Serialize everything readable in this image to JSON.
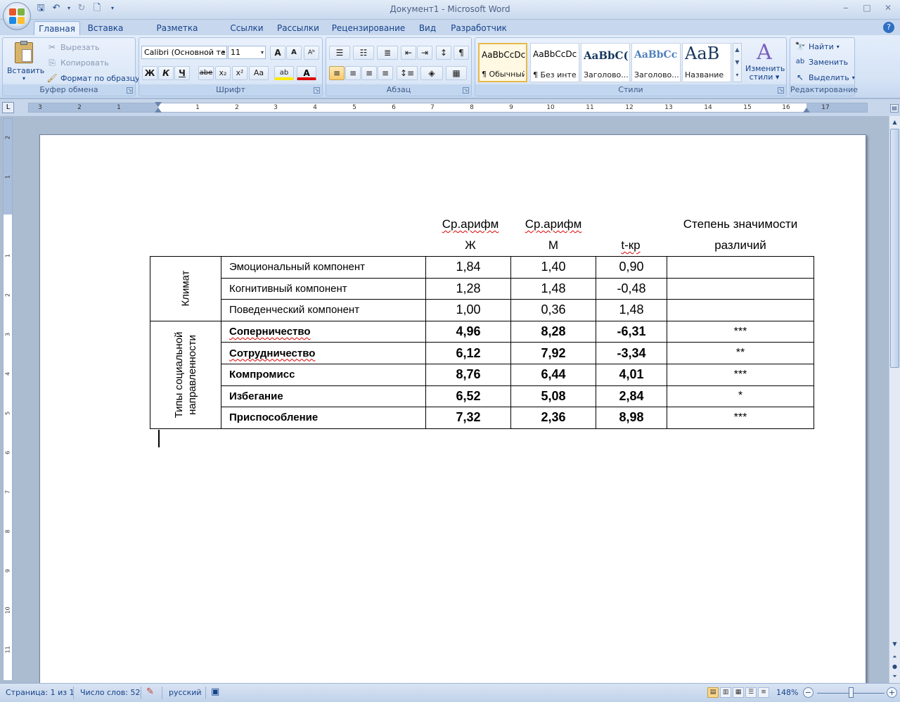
{
  "window": {
    "title": "Документ1 - Microsoft Word",
    "controls": [
      "‒",
      "□",
      "✕"
    ]
  },
  "qat": [
    "save-icon",
    "undo-icon",
    "redo-icon",
    "print-preview-icon"
  ],
  "tabs": [
    "Главная",
    "Вставка",
    "Разметка страницы",
    "Ссылки",
    "Рассылки",
    "Рецензирование",
    "Вид",
    "Разработчик"
  ],
  "ribbon": {
    "clipboard": {
      "label": "Буфер обмена",
      "paste": "Вставить",
      "cut": "Вырезать",
      "copy": "Копировать",
      "format_painter": "Формат по образцу"
    },
    "font": {
      "label": "Шрифт",
      "font_name": "Calibri (Основной те",
      "font_size": "11",
      "grow": "A",
      "shrink": "A",
      "clear": "Aᵇ",
      "bold": "Ж",
      "italic": "К",
      "underline": "Ч",
      "strike": "abe",
      "subscript": "x₂",
      "superscript": "x²",
      "case": "Aa",
      "highlight": "ab",
      "font_color": "A"
    },
    "paragraph": {
      "label": "Абзац"
    },
    "styles": {
      "label": "Стили",
      "tiles": [
        {
          "sample": "AaBbCcDc",
          "name": "¶ Обычный"
        },
        {
          "sample": "AaBbCcDc",
          "name": "¶ Без инте..."
        },
        {
          "sample": "AaBbC(",
          "name": "Заголово..."
        },
        {
          "sample": "AaBbCc",
          "name": "Заголово..."
        },
        {
          "sample": "AaB",
          "name": "Название"
        }
      ],
      "change_styles_1": "Изменить",
      "change_styles_2": "стили"
    },
    "editing": {
      "label": "Редактирование",
      "find": "Найти",
      "replace": "Заменить",
      "select": "Выделить"
    }
  },
  "ruler": {
    "tab_selector": "L",
    "left_numbers": [
      "3",
      "2",
      "1"
    ],
    "right_numbers": [
      "1",
      "2",
      "3",
      "4",
      "5",
      "6",
      "7",
      "8",
      "9",
      "10",
      "11",
      "12",
      "13",
      "14",
      "15",
      "16",
      "17"
    ],
    "vertical_numbers": [
      "2",
      "1",
      "1",
      "2",
      "3",
      "4",
      "5",
      "6",
      "7",
      "8",
      "9",
      "10",
      "11"
    ]
  },
  "document": {
    "headers": {
      "col_f_1": "Ср.арифм",
      "col_f_2": "Ж",
      "col_m_1": "Ср.арифм",
      "col_m_2": "М",
      "col_t": "t-кр",
      "col_sig_1": "Степень значимости",
      "col_sig_2": "различий"
    },
    "groups": {
      "climate": "Климат",
      "social_1": "Типы социальной",
      "social_2": "направленности"
    },
    "rows": [
      {
        "label": "Эмоциональный компонент",
        "f": "1,84",
        "m": "1,40",
        "t": "0,90",
        "sig": ""
      },
      {
        "label": "Когнитивный компонент",
        "f": "1,28",
        "m": "1,48",
        "t": "-0,48",
        "sig": ""
      },
      {
        "label": "Поведенческий компонент",
        "f": "1,00",
        "m": "0,36",
        "t": "1,48",
        "sig": ""
      },
      {
        "label": "Соперничество",
        "f": "4,96",
        "m": "8,28",
        "t": "-6,31",
        "sig": "***"
      },
      {
        "label": "Сотрудничество",
        "f": "6,12",
        "m": "7,92",
        "t": "-3,34",
        "sig": "**"
      },
      {
        "label": "Компромисс",
        "f": "8,76",
        "m": "6,44",
        "t": "4,01",
        "sig": "***"
      },
      {
        "label": "Избегание",
        "f": "6,52",
        "m": "5,08",
        "t": "2,84",
        "sig": "*"
      },
      {
        "label": "Приспособление",
        "f": "7,32",
        "m": "2,36",
        "t": "8,98",
        "sig": "***"
      }
    ]
  },
  "statusbar": {
    "page": "Страница: 1 из 1",
    "words": "Число слов: 52",
    "language": "русский",
    "zoom": "148%",
    "zoom_out": "−",
    "zoom_in": "+"
  }
}
